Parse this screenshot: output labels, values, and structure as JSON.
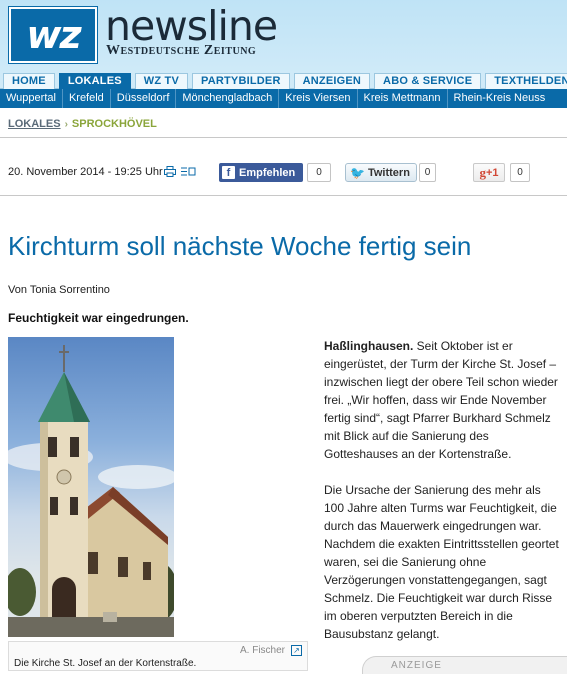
{
  "masthead": {
    "logo_text": "wz",
    "brand_name": "newsline",
    "brand_sub": "Westdeutsche Zeitung"
  },
  "main_nav": [
    {
      "label": "HOME",
      "active": false
    },
    {
      "label": "LOKALES",
      "active": true
    },
    {
      "label": "WZ TV",
      "active": false
    },
    {
      "label": "PARTYBILDER",
      "active": false
    },
    {
      "label": "ANZEIGEN",
      "active": false
    },
    {
      "label": "ABO & SERVICE",
      "active": false
    },
    {
      "label": "TEXTHELDEN",
      "active": false
    }
  ],
  "sub_nav": [
    "Wuppertal",
    "Krefeld",
    "Düsseldorf",
    "Mönchengladbach",
    "Kreis Viersen",
    "Kreis Mettmann",
    "Rhein-Kreis Neuss"
  ],
  "breadcrumb": {
    "parent": "LOKALES",
    "separator": "›",
    "current": "SPROCKHÖVEL"
  },
  "meta": {
    "date": "20. November 2014 - 19:25 Uhr",
    "print_icon": "printer-icon",
    "text_icon": "text-size-icon"
  },
  "social": {
    "facebook_label": "Empfehlen",
    "facebook_count": "0",
    "twitter_label": "Twittern",
    "twitter_count": "0",
    "gplus_label": "+1",
    "gplus_count": "0"
  },
  "article": {
    "headline": "Kirchturm soll nächste Woche fertig sein",
    "byline": "Von Tonia Sorrentino",
    "teaser": "Feuchtigkeit war eingedrungen.",
    "p1_lead": "Haßlinghausen.",
    "p1_text": " Seit Oktober ist er eingerüstet, der Turm der Kirche St. Josef – inzwischen liegt der obere Teil schon wieder frei. „Wir hoffen, dass wir Ende November fertig sind“, sagt Pfarrer Burkhard Schmelz mit Blick auf die Sanierung des Gotteshauses an der Kortenstraße.",
    "p2_text": "Die Ursache der Sanierung des mehr als 100 Jahre alten Turms war Feuchtigkeit, die durch das Mauerwerk eingedrungen war. Nachdem die exakten Eintrittsstellen geortet waren, sei die Sanierung ohne Verzögerungen vonstattengegangen, sagt Schmelz. Die Feuchtigkeit war durch Risse im oberen verputzten Bereich in die Bausubstanz gelangt."
  },
  "photo": {
    "credit": "A. Fischer",
    "caption": "Die Kirche St. Josef an der Kortenstraße."
  },
  "ad_tab": {
    "label": "ANZEIGE"
  },
  "colors": {
    "brand_blue": "#0a6aa8",
    "masthead_bg": "#cfeaf8",
    "breadcrumb_green": "#8aa53a",
    "facebook": "#3b5a9a"
  }
}
